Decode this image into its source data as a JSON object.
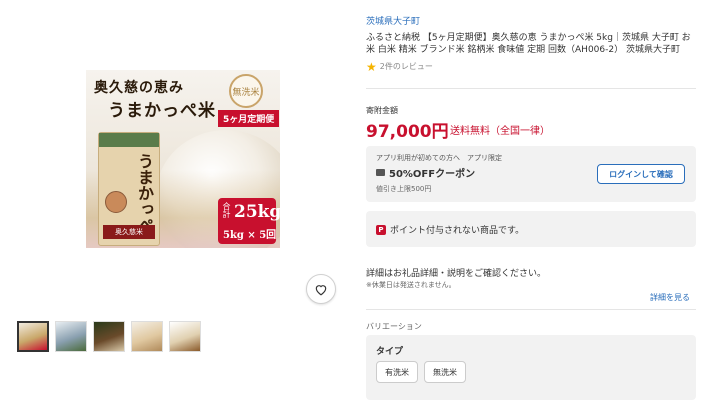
{
  "product_image": {
    "headline1": "奥久慈の恵み",
    "headline2": "うまかっぺ米",
    "badge_teiki": "5ヶ月定期便",
    "seal_text": "無洗米",
    "bag_brand": "うまかっぺ",
    "bag_label": "奥久慈米",
    "total_prefix": "合計",
    "total_amount": "25kg",
    "total_breakdown": "5kg × 5回"
  },
  "favorite": {
    "icon": "heart-outline-icon"
  },
  "thumbnails": [
    {
      "colors": [
        "#f2ece0",
        "#c9a86a",
        "#c8102e"
      ],
      "selected": true
    },
    {
      "colors": [
        "#e8eef2",
        "#8aa0b0",
        "#4a6a3a"
      ],
      "selected": false
    },
    {
      "colors": [
        "#2a3a1a",
        "#6a4a2a",
        "#d8c8a8"
      ],
      "selected": false
    },
    {
      "colors": [
        "#f4efe6",
        "#e0c8a0",
        "#b08a5a"
      ],
      "selected": false
    },
    {
      "colors": [
        "#ffffff",
        "#e0d0b0",
        "#8a5a2a"
      ],
      "selected": false
    }
  ],
  "municipality": "茨城県大子町",
  "title": "ふるさと納税 【5ヶ月定期便】奥久慈の恵 うまかっぺ米 5kg｜茨城県 大子町 お米 白米 精米 ブランド米 銘柄米 食味値 定期 回数（AH006-2） 茨城県大子町",
  "rating": {
    "reviews": "2件のレビュー"
  },
  "donation": {
    "label": "寄附金額",
    "amount": "97,000円",
    "shipping": "送料無料（全国一律）"
  },
  "coupon": {
    "note": "アプリ利用が初めての方へ　アプリ限定",
    "title": "50%OFFクーポン",
    "limit": "値引き上限500円",
    "login_label": "ログインして確認"
  },
  "points": {
    "text": "ポイント付与されない商品です。",
    "icon_char": "P"
  },
  "details": {
    "text": "詳細はお礼品詳細・説明をご確認ください。",
    "note": "※休業日は発送されません。",
    "link": "詳細を見る"
  },
  "variation": {
    "label": "バリエーション",
    "type_label": "タイプ",
    "options": [
      "有洗米",
      "無洗米"
    ]
  },
  "colors": {
    "accent_red": "#c8102e",
    "link_blue": "#2a6ebb",
    "star": "#f5b400"
  }
}
